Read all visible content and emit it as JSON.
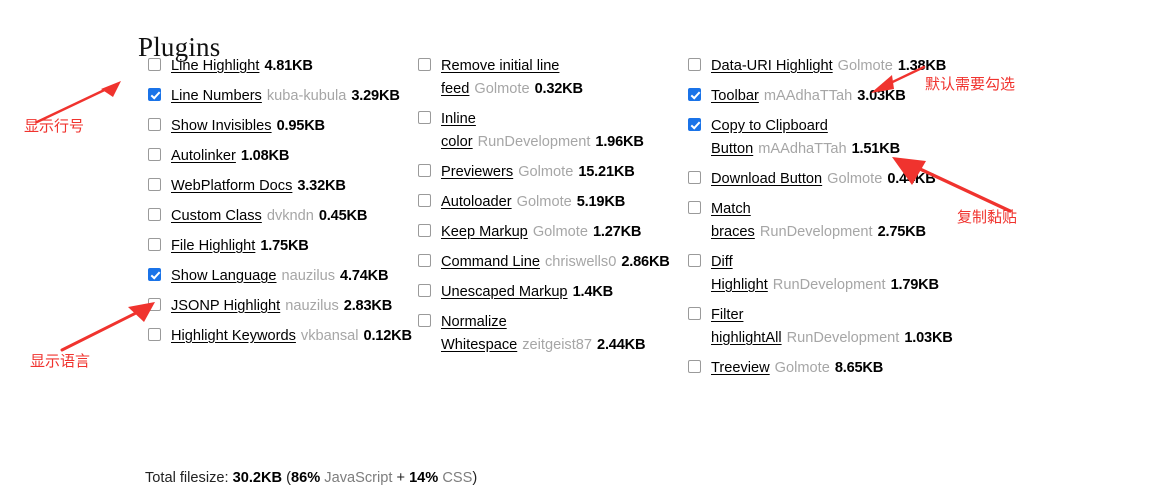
{
  "page": {
    "title": "Plugins"
  },
  "columns": [
    {
      "id": "column-1",
      "plugins": [
        {
          "name": "Line Highlight",
          "author": "",
          "size": "4.81KB",
          "checked": false
        },
        {
          "name": "Line Numbers",
          "author": "kuba-kubula",
          "size": "3.29KB",
          "checked": true
        },
        {
          "name": "Show Invisibles",
          "author": "",
          "size": "0.95KB",
          "checked": false
        },
        {
          "name": "Autolinker",
          "author": "",
          "size": "1.08KB",
          "checked": false
        },
        {
          "name": "WebPlatform Docs",
          "author": "",
          "size": "3.32KB",
          "checked": false
        },
        {
          "name": "Custom Class",
          "author": "dvkndn",
          "size": "0.45KB",
          "checked": false
        },
        {
          "name": "File Highlight",
          "author": "",
          "size": "1.75KB",
          "checked": false
        },
        {
          "name": "Show Language",
          "author": "nauzilus",
          "size": "4.74KB",
          "checked": true
        },
        {
          "name": "JSONP Highlight",
          "author": "nauzilus",
          "size": "2.83KB",
          "checked": false
        },
        {
          "name": "Highlight Keywords",
          "author": "vkbansal",
          "size": "0.12KB",
          "checked": false
        }
      ]
    },
    {
      "id": "column-2",
      "plugins": [
        {
          "name": "Remove initial line feed",
          "author": "Golmote",
          "size": "0.32KB",
          "checked": false
        },
        {
          "name": "Inline color",
          "author": "RunDevelopment",
          "size": "1.96KB",
          "checked": false
        },
        {
          "name": "Previewers",
          "author": "Golmote",
          "size": "15.21KB",
          "checked": false
        },
        {
          "name": "Autoloader",
          "author": "Golmote",
          "size": "5.19KB",
          "checked": false
        },
        {
          "name": "Keep Markup",
          "author": "Golmote",
          "size": "1.27KB",
          "checked": false
        },
        {
          "name": "Command Line",
          "author": "chriswells0",
          "size": "2.86KB",
          "checked": false
        },
        {
          "name": "Unescaped Markup",
          "author": "",
          "size": "1.4KB",
          "checked": false
        },
        {
          "name": "Normalize Whitespace",
          "author": "zeitgeist87",
          "size": "2.44KB",
          "checked": false
        }
      ]
    },
    {
      "id": "column-3",
      "plugins": [
        {
          "name": "Data-URI Highlight",
          "author": "Golmote",
          "size": "1.38KB",
          "checked": false
        },
        {
          "name": "Toolbar",
          "author": "mAAdhaTTah",
          "size": "3.03KB",
          "checked": true
        },
        {
          "name": "Copy to Clipboard Button",
          "author": "mAAdhaTTah",
          "size": "1.51KB",
          "checked": true
        },
        {
          "name": "Download Button",
          "author": "Golmote",
          "size": "0.44KB",
          "checked": false
        },
        {
          "name": "Match braces",
          "author": "RunDevelopment",
          "size": "2.75KB",
          "checked": false
        },
        {
          "name": "Diff Highlight",
          "author": "RunDevelopment",
          "size": "1.79KB",
          "checked": false
        },
        {
          "name": "Filter highlightAll",
          "author": "RunDevelopment",
          "size": "1.03KB",
          "checked": false
        },
        {
          "name": "Treeview",
          "author": "Golmote",
          "size": "8.65KB",
          "checked": false
        }
      ]
    }
  ],
  "footer": {
    "label": "Total filesize: ",
    "total": "30.2KB",
    "open_paren": " (",
    "js_percent": "86%",
    "js_label": " JavaScript",
    "plus": " + ",
    "css_percent": "14%",
    "css_label": " CSS",
    "close_paren": ")"
  },
  "annotations": [
    {
      "id": "annot-line-numbers",
      "text": "显示行号"
    },
    {
      "id": "annot-show-language",
      "text": "显示语言"
    },
    {
      "id": "annot-default-check",
      "text": "默认需要勾选"
    },
    {
      "id": "annot-copy-paste",
      "text": "复制黏贴"
    }
  ],
  "colors": {
    "checkbox_checked": "#1a73e8",
    "annotation_red": "#f0332e",
    "author_grey": "#a6a6a6"
  }
}
